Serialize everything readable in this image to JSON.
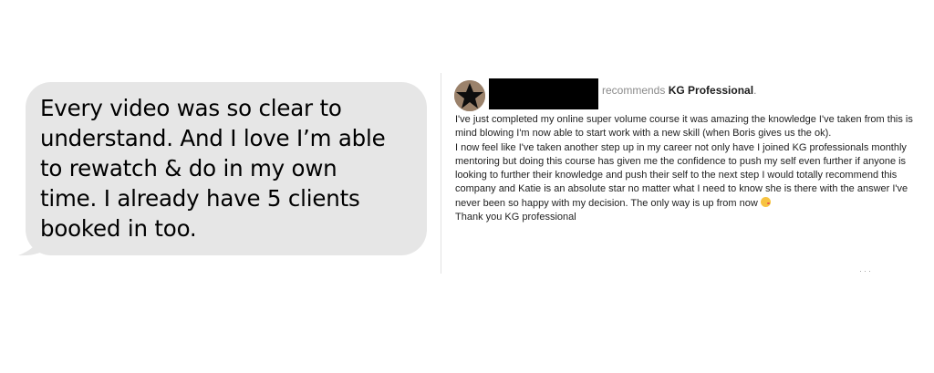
{
  "message_bubble": {
    "text": "Every video was so clear to\nunderstand. And I love I’m able\nto rewatch & do in my own\ntime. I already have 5 clients\nbooked in too.",
    "background": "#e6e6e6"
  },
  "recommendation": {
    "recommends_text": "recommends",
    "company": "KG Professional",
    "period": ".",
    "paragraphs": [
      "I've just completed my online super volume course it was amazing the knowledge I've taken from this is mind blowing I'm now able to start work with a new skill (when Boris gives us the ok).",
      "I now feel like I've taken another step up in my career not only have I joined KG professionals monthly mentoring but doing this course has given me the confidence to push my self even further if anyone is looking to further their knowledge and push their self to the next step I would totally recommend this company and Katie is an absolute star no matter what I need to know she is there with the answer I've never been so happy with my decision. The only way is up from now",
      "Thank you KG professional"
    ],
    "emoji": "kissing-face-emoji",
    "more_indicator": "···"
  }
}
